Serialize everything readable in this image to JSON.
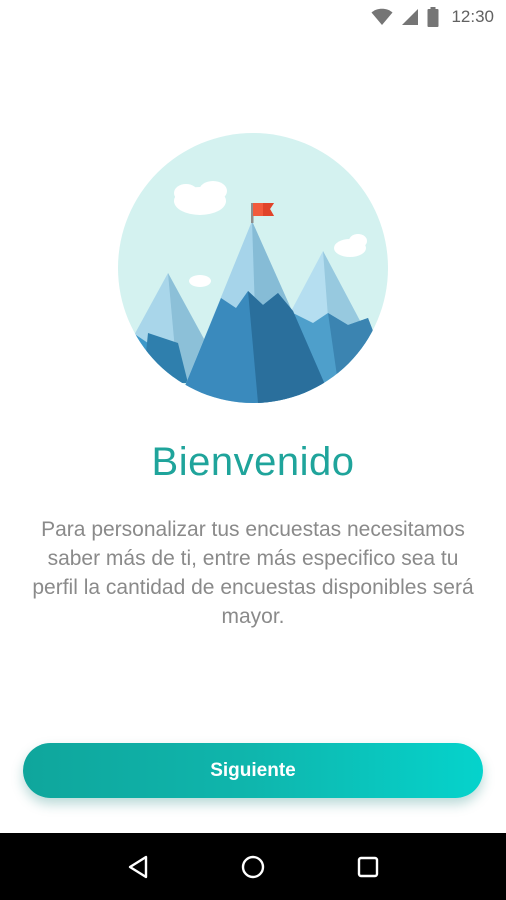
{
  "status_bar": {
    "time": "12:30",
    "icons": [
      "wifi-icon",
      "cellular-signal-icon",
      "battery-icon"
    ]
  },
  "welcome": {
    "title": "Bienvenido",
    "description": "Para personalizar tus encuestas necesitamos saber más de ti, entre más especifico sea tu perfil la cantidad de encuestas disponibles será mayor."
  },
  "actions": {
    "next_label": "Siguiente"
  },
  "navigation": {
    "icons": [
      "back-triangle-icon",
      "home-circle-icon",
      "recents-square-icon"
    ]
  },
  "colors": {
    "accent": "#1fa49b",
    "button_start": "#0fa69c",
    "button_end": "#05d3cc",
    "text_muted": "#8a8a8a"
  }
}
